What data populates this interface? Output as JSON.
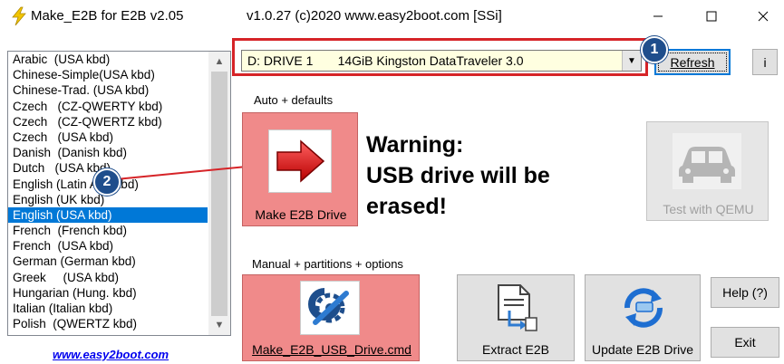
{
  "window": {
    "title": "Make_E2B for E2B v2.05",
    "subtitle": "v1.0.27  (c)2020 www.easy2boot.com [SSi]",
    "icon": "lightning-icon",
    "controls": {
      "minimize": "minimize-icon",
      "maximize": "maximize-icon",
      "close": "close-icon"
    }
  },
  "keyboard_list": {
    "items": [
      "Arabic  (USA kbd)",
      "Chinese-Simple(USA kbd)",
      "Chinese-Trad. (USA kbd)",
      "Czech   (CZ-QWERTY kbd)",
      "Czech   (CZ-QWERTZ kbd)",
      "Czech   (USA kbd)",
      "Danish  (Danish kbd)",
      "Dutch   (USA kbd)",
      "English (Latin Am. kbd)",
      "English (UK kbd)",
      "English (USA kbd)",
      "French  (French kbd)",
      "French  (USA kbd)",
      "German (German kbd)",
      "Greek     (USA kbd)",
      "Hungarian (Hung. kbd)",
      "Italian (Italian kbd)",
      "Polish  (QWERTZ kbd)"
    ],
    "selected_index": 10
  },
  "link": "www.easy2boot.com",
  "drive": {
    "value": "D: DRIVE 1       14GiB Kingston DataTraveler 3.0"
  },
  "buttons": {
    "refresh": "Refresh",
    "info": "i",
    "make_drive": "Make E2B Drive",
    "test_qemu": "Test with QEMU",
    "make_cmd": "Make_E2B_USB_Drive.cmd",
    "extract": "Extract E2B",
    "update": "Update E2B Drive",
    "help": "Help (?)",
    "exit": "Exit"
  },
  "labels": {
    "auto": "Auto + defaults",
    "manual": "Manual + partitions + options"
  },
  "warning": {
    "line1": "Warning:",
    "line2": "USB drive will be",
    "line3": "erased!"
  },
  "annotations": {
    "badge1": "1",
    "badge2": "2"
  },
  "colors": {
    "accent_red": "#d62428",
    "make_button": "#f08a8a",
    "selection": "#0078d7",
    "badge": "#1f4e8c"
  }
}
